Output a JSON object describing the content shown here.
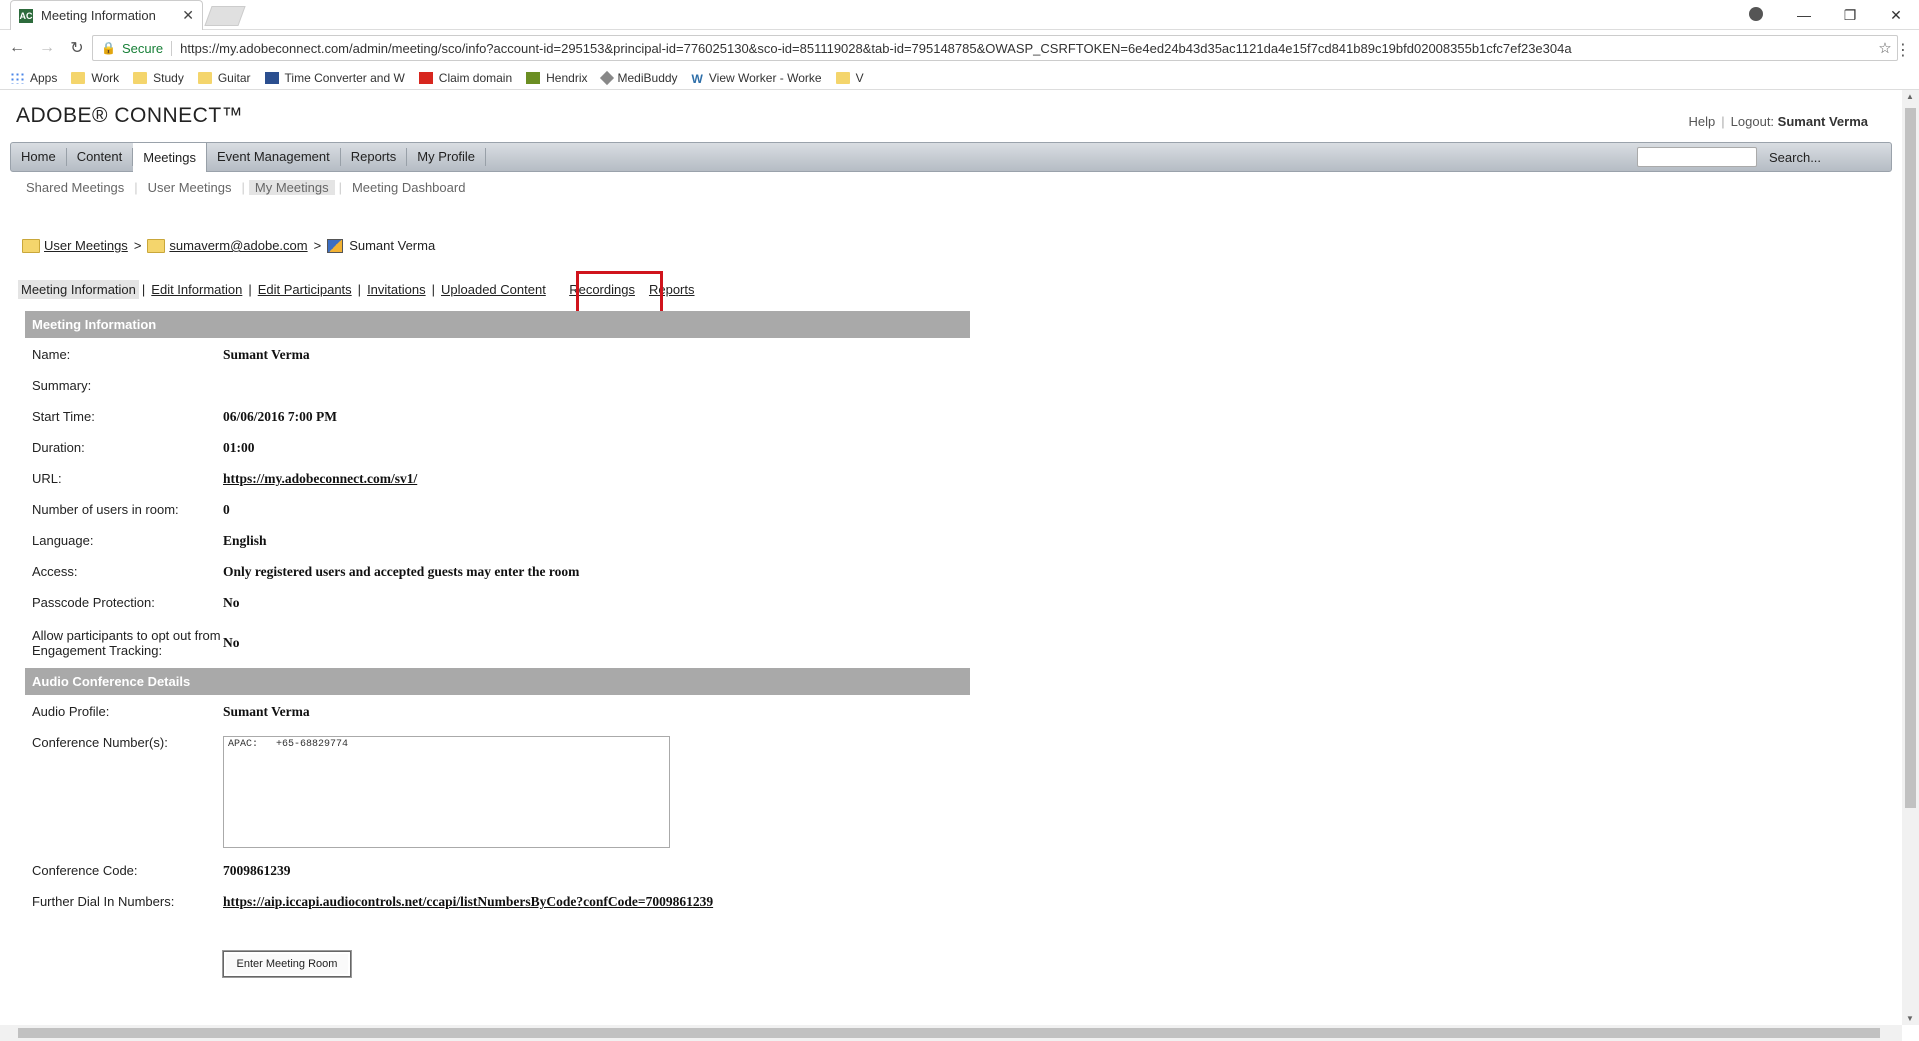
{
  "browser": {
    "tab_title": "Meeting Information",
    "secure_label": "Secure",
    "url": "https://my.adobeconnect.com/admin/meeting/sco/info?account-id=295153&principal-id=776025130&sco-id=851119028&tab-id=795148785&OWASP_CSRFTOKEN=6e4ed24b43d35ac1121da4e15f7cd841b89c19bfd02008355b1cfc7ef23e304a",
    "bookmarks": [
      "Apps",
      "Work",
      "Study",
      "Guitar",
      "Time Converter and W",
      "Claim domain",
      "Hendrix",
      "MediBuddy",
      "View Worker - Worke",
      "V"
    ]
  },
  "app": {
    "logo": "ADOBE® CONNECT™",
    "help": "Help",
    "logout_label": "Logout:",
    "user": "Sumant Verma",
    "nav": [
      "Home",
      "Content",
      "Meetings",
      "Event Management",
      "Reports",
      "My Profile"
    ],
    "search_label": "Search...",
    "subnav": [
      "Shared Meetings",
      "User Meetings",
      "My Meetings",
      "Meeting Dashboard"
    ]
  },
  "breadcrumb": {
    "folder1": "User Meetings",
    "folder2": "sumaverm@adobe.com",
    "meeting": "Sumant Verma",
    "separator": ">"
  },
  "tabs": [
    "Meeting Information",
    "Edit Information",
    "Edit Participants",
    "Invitations",
    "Uploaded Content",
    "Recordings",
    "Reports"
  ],
  "meeting_info": {
    "header": "Meeting Information",
    "rows": [
      {
        "label": "Name:",
        "value": "Sumant Verma"
      },
      {
        "label": "Summary:",
        "value": ""
      },
      {
        "label": "Start Time:",
        "value": "06/06/2016 7:00 PM"
      },
      {
        "label": "Duration:",
        "value": "01:00"
      },
      {
        "label": "URL:",
        "value": "https://my.adobeconnect.com/sv1/"
      },
      {
        "label": "Number of users in room:",
        "value": "0"
      },
      {
        "label": "Language:",
        "value": "English"
      },
      {
        "label": "Access:",
        "value": "Only registered users and accepted guests may enter the room"
      },
      {
        "label": "Passcode Protection:",
        "value": "No"
      },
      {
        "label": "Allow participants to opt out from Engagement Tracking:",
        "value": "No"
      }
    ]
  },
  "audio": {
    "header": "Audio Conference Details",
    "profile_label": "Audio Profile:",
    "profile_value": "Sumant Verma",
    "numbers_label": "Conference Number(s):",
    "numbers_value": "APAC:   +65-68829774",
    "code_label": "Conference Code:",
    "code_value": "7009861239",
    "dial_label": "Further Dial In Numbers:",
    "dial_value": "https://aip.iccapi.audiocontrols.net/ccapi/listNumbersByCode?confCode=7009861239"
  },
  "enter_button": "Enter Meeting Room"
}
